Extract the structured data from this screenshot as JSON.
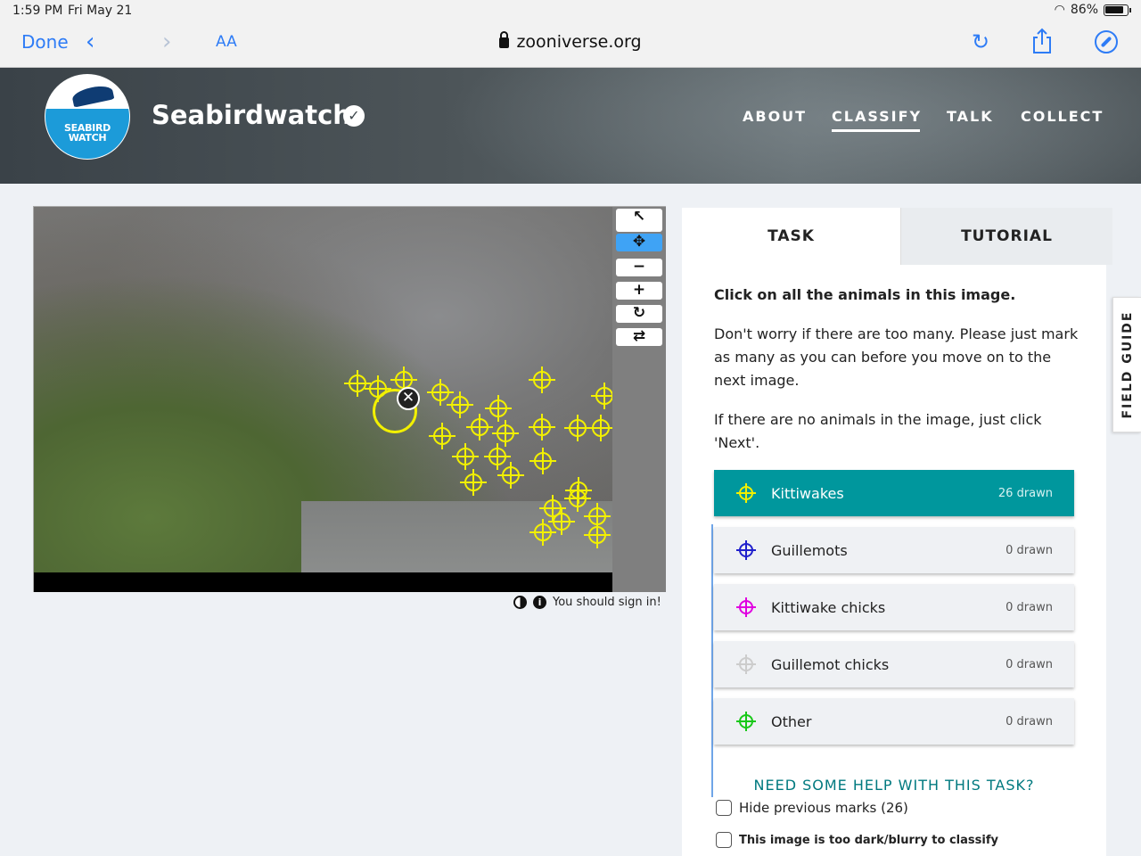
{
  "status_bar": {
    "time": "1:59 PM",
    "date": "Fri May 21",
    "battery": "86%"
  },
  "browser": {
    "done_label": "Done",
    "text_size_label": "AA",
    "url": "zooniverse.org"
  },
  "project": {
    "name": "Seabirdwatch",
    "logo_text": "SEABIRD WATCH",
    "nav": [
      {
        "label": "ABOUT"
      },
      {
        "label": "CLASSIFY",
        "active": true
      },
      {
        "label": "TALK"
      },
      {
        "label": "COLLECT"
      }
    ]
  },
  "viewer": {
    "tools": [
      "pointer-icon",
      "pan-icon",
      "zoom-out-icon",
      "zoom-in-icon",
      "rotate-icon",
      "reset-icon"
    ],
    "marks_color": "#f2f000",
    "marks_drawn": 26,
    "signin_text": "You should sign in!"
  },
  "task_panel": {
    "tabs": {
      "task": "TASK",
      "tutorial": "TUTORIAL"
    },
    "question": "Click on all the animals in this image.",
    "help_1": "Don't worry if there are too many. Please just mark as many as you can before you move on to the next image.",
    "help_2": "If there are no animals in the image, just click 'Next'.",
    "choices": [
      {
        "label": "Kittiwakes",
        "count": "26 drawn",
        "color": "#f2f000",
        "selected": true
      },
      {
        "label": "Guillemots",
        "count": "0 drawn",
        "color": "#2020cc"
      },
      {
        "label": "Kittiwake chicks",
        "count": "0 drawn",
        "color": "#e000e0"
      },
      {
        "label": "Guillemot chicks",
        "count": "0 drawn",
        "color": "#cccccc"
      },
      {
        "label": "Other",
        "count": "0 drawn",
        "color": "#18c818"
      }
    ],
    "need_help": "NEED SOME HELP WITH THIS TASK?",
    "hide_marks": "Hide previous marks (26)",
    "too_dark": "This image is too dark/blurry to classify"
  },
  "field_guide": "FIELD GUIDE"
}
